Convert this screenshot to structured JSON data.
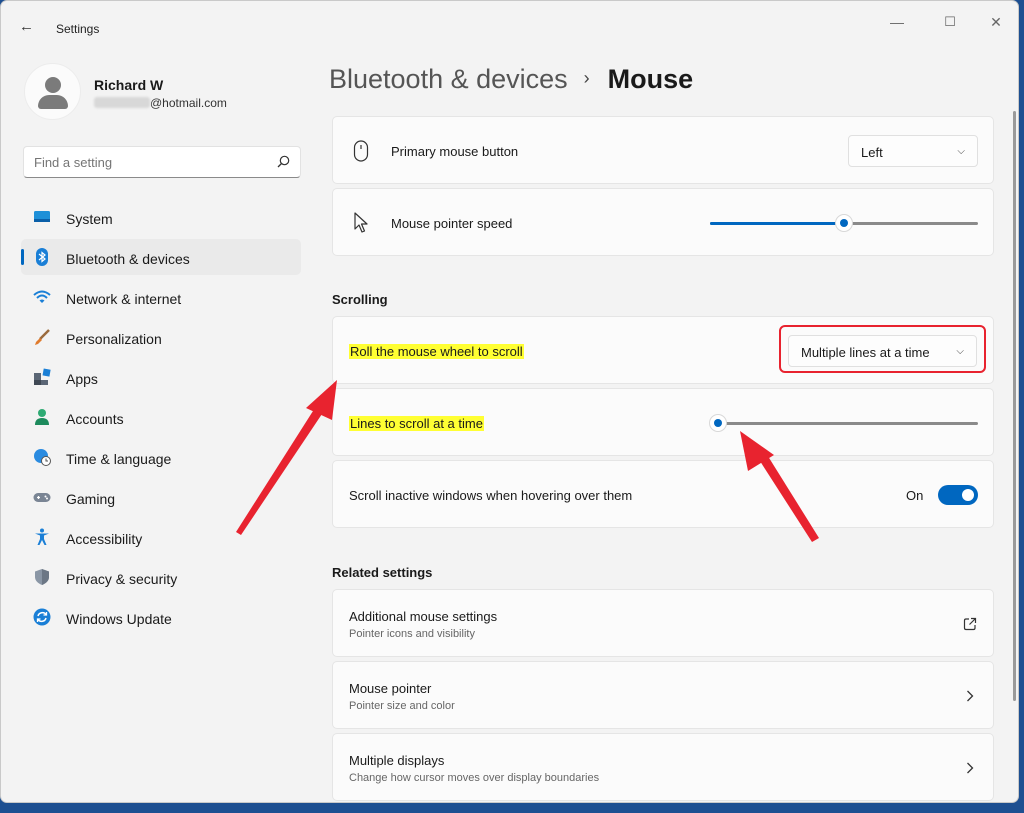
{
  "window": {
    "title": "Settings",
    "back_glyph": "←",
    "minimize_glyph": "—",
    "maximize_glyph": "☐",
    "close_glyph": "✕"
  },
  "user": {
    "name": "Richard W",
    "email_suffix": "@hotmail.com"
  },
  "search": {
    "placeholder": "Find a setting"
  },
  "sidebar": {
    "items": [
      {
        "label": "System",
        "icon": "system-icon"
      },
      {
        "label": "Bluetooth & devices",
        "icon": "bluetooth-icon",
        "active": true
      },
      {
        "label": "Network & internet",
        "icon": "wifi-icon"
      },
      {
        "label": "Personalization",
        "icon": "brush-icon"
      },
      {
        "label": "Apps",
        "icon": "apps-icon"
      },
      {
        "label": "Accounts",
        "icon": "accounts-icon"
      },
      {
        "label": "Time & language",
        "icon": "globe-clock-icon"
      },
      {
        "label": "Gaming",
        "icon": "gamepad-icon"
      },
      {
        "label": "Accessibility",
        "icon": "accessibility-icon"
      },
      {
        "label": "Privacy & security",
        "icon": "shield-icon"
      },
      {
        "label": "Windows Update",
        "icon": "update-icon"
      }
    ]
  },
  "breadcrumb": {
    "parent": "Bluetooth & devices",
    "separator": "›",
    "current": "Mouse"
  },
  "settings": {
    "primary_button": {
      "label": "Primary mouse button",
      "value": "Left"
    },
    "pointer_speed": {
      "label": "Mouse pointer speed",
      "level": 0.5
    },
    "scrolling_title": "Scrolling",
    "roll_wheel": {
      "label": "Roll the mouse wheel to scroll",
      "value": "Multiple lines at a time"
    },
    "lines_to_scroll": {
      "label": "Lines to scroll at a time",
      "level": 0.03
    },
    "scroll_inactive": {
      "label": "Scroll inactive windows when hovering over them",
      "state": "On"
    },
    "related_title": "Related settings",
    "additional_mouse": {
      "label": "Additional mouse settings",
      "sub": "Pointer icons and visibility"
    },
    "mouse_pointer": {
      "label": "Mouse pointer",
      "sub": "Pointer size and color"
    },
    "multiple_displays": {
      "label": "Multiple displays",
      "sub": "Change how cursor moves over display boundaries"
    }
  },
  "colors": {
    "accent": "#0067c0",
    "highlight": "#ffff33",
    "annotation_red": "#e8232f"
  }
}
